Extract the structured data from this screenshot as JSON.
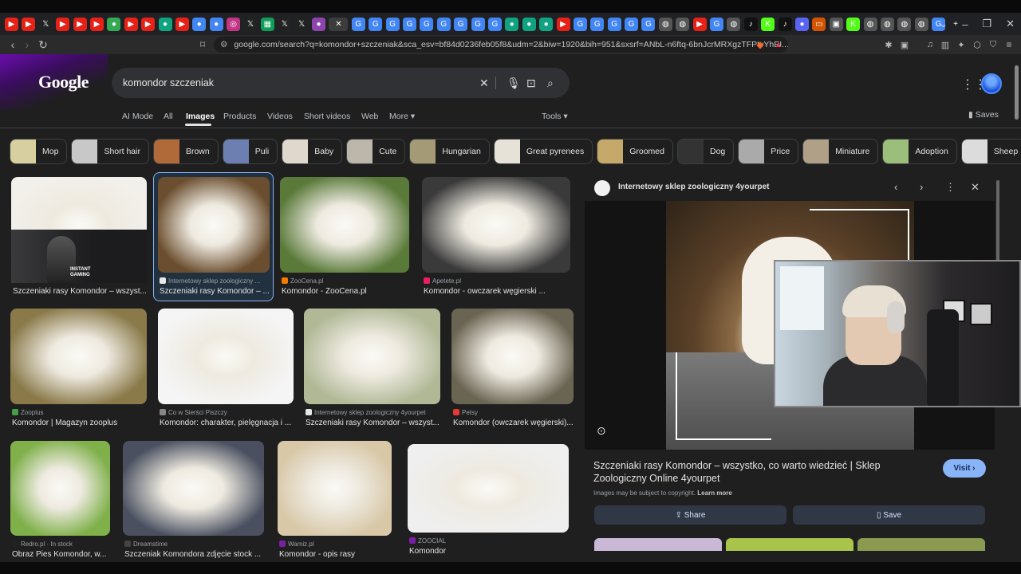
{
  "browser": {
    "url": "google.com/search?q=komondor+szczeniak&sca_esv=bf84d0236feb05f8&udm=2&biw=1920&bih=951&sxsrf=ANbL-n6ftq-6bnJcrMRXgzTFPtvYhEI...",
    "tabs": [
      {
        "icon": "youtube-icon",
        "color": "#e62117",
        "glyph": "▶"
      },
      {
        "icon": "youtube-icon",
        "color": "#e62117",
        "glyph": "▶"
      },
      {
        "icon": "x-icon",
        "color": "#222",
        "glyph": "𝕏"
      },
      {
        "icon": "youtube-icon",
        "color": "#e62117",
        "glyph": "▶"
      },
      {
        "icon": "youtube-icon",
        "color": "#e62117",
        "glyph": "▶"
      },
      {
        "icon": "youtube-icon",
        "color": "#e62117",
        "glyph": "▶"
      },
      {
        "icon": "maps-icon",
        "color": "#34a853",
        "glyph": "●"
      },
      {
        "icon": "youtube-icon",
        "color": "#e62117",
        "glyph": "▶"
      },
      {
        "icon": "youtube-icon",
        "color": "#e62117",
        "glyph": "▶"
      },
      {
        "icon": "chat-icon",
        "color": "#10a37f",
        "glyph": "●"
      },
      {
        "icon": "youtube-icon",
        "color": "#e62117",
        "glyph": "▶"
      },
      {
        "icon": "chrome-icon",
        "color": "#4285f4",
        "glyph": "●"
      },
      {
        "icon": "chrome-icon",
        "color": "#4285f4",
        "glyph": "●"
      },
      {
        "icon": "instagram-icon",
        "color": "#c13584",
        "glyph": "◎"
      },
      {
        "icon": "x-icon",
        "color": "#222",
        "glyph": "𝕏"
      },
      {
        "icon": "sheets-icon",
        "color": "#0f9d58",
        "glyph": "▦"
      },
      {
        "icon": "x-icon",
        "color": "#222",
        "glyph": "𝕏"
      },
      {
        "icon": "x-icon",
        "color": "#222",
        "glyph": "𝕏"
      },
      {
        "icon": "app-icon",
        "color": "#8e44ad",
        "glyph": "●"
      },
      {
        "icon": "close-tab-icon",
        "color": "#3c3c3c",
        "glyph": "✕",
        "active": true
      },
      {
        "icon": "google-icon",
        "color": "#4285f4",
        "glyph": "G"
      },
      {
        "icon": "google-icon",
        "color": "#4285f4",
        "glyph": "G"
      },
      {
        "icon": "google-icon",
        "color": "#4285f4",
        "glyph": "G"
      },
      {
        "icon": "google-icon",
        "color": "#4285f4",
        "glyph": "G"
      },
      {
        "icon": "google-icon",
        "color": "#4285f4",
        "glyph": "G"
      },
      {
        "icon": "google-icon",
        "color": "#4285f4",
        "glyph": "G"
      },
      {
        "icon": "google-icon",
        "color": "#4285f4",
        "glyph": "G"
      },
      {
        "icon": "google-icon",
        "color": "#4285f4",
        "glyph": "G"
      },
      {
        "icon": "google-icon",
        "color": "#4285f4",
        "glyph": "G"
      },
      {
        "icon": "chat-icon",
        "color": "#10a37f",
        "glyph": "●"
      },
      {
        "icon": "chat-icon",
        "color": "#10a37f",
        "glyph": "●"
      },
      {
        "icon": "chat-icon",
        "color": "#10a37f",
        "glyph": "●"
      },
      {
        "icon": "youtube-icon",
        "color": "#e62117",
        "glyph": "▶"
      },
      {
        "icon": "google-icon",
        "color": "#4285f4",
        "glyph": "G"
      },
      {
        "icon": "google-icon",
        "color": "#4285f4",
        "glyph": "G"
      },
      {
        "icon": "google-icon",
        "color": "#4285f4",
        "glyph": "G"
      },
      {
        "icon": "google-icon",
        "color": "#4285f4",
        "glyph": "G"
      },
      {
        "icon": "google-icon",
        "color": "#4285f4",
        "glyph": "G"
      },
      {
        "icon": "globe-icon",
        "color": "#555",
        "glyph": "◍"
      },
      {
        "icon": "globe-icon",
        "color": "#555",
        "glyph": "◍"
      },
      {
        "icon": "youtube-icon",
        "color": "#e62117",
        "glyph": "▶"
      },
      {
        "icon": "google-icon",
        "color": "#4285f4",
        "glyph": "G"
      },
      {
        "icon": "globe-icon",
        "color": "#555",
        "glyph": "◍"
      },
      {
        "icon": "tiktok-icon",
        "color": "#111",
        "glyph": "♪"
      },
      {
        "icon": "kick-icon",
        "color": "#53fc18",
        "glyph": "K"
      },
      {
        "icon": "tiktok-icon",
        "color": "#111",
        "glyph": "♪"
      },
      {
        "icon": "discord-icon",
        "color": "#5865f2",
        "glyph": "●"
      },
      {
        "icon": "app-icon",
        "color": "#d35400",
        "glyph": "▭"
      },
      {
        "icon": "app-icon",
        "color": "#555",
        "glyph": "▣"
      },
      {
        "icon": "kick-icon",
        "color": "#53fc18",
        "glyph": "K"
      },
      {
        "icon": "globe-icon",
        "color": "#555",
        "glyph": "◍"
      },
      {
        "icon": "globe-icon",
        "color": "#555",
        "glyph": "◍"
      },
      {
        "icon": "globe-icon",
        "color": "#555",
        "glyph": "◍"
      },
      {
        "icon": "globe-icon",
        "color": "#555",
        "glyph": "◍"
      },
      {
        "icon": "google-icon",
        "color": "#4285f4",
        "glyph": "G"
      },
      {
        "icon": "new-tab-icon",
        "color": "#202124",
        "glyph": "+"
      }
    ]
  },
  "header": {
    "logo_text": "Google",
    "search_query": "komondor szczeniak",
    "nav_tabs": [
      "AI Mode",
      "All",
      "Images",
      "Products",
      "Videos",
      "Short videos",
      "Web",
      "More ▾"
    ],
    "active_tab": "Images",
    "tools_label": "Tools ▾",
    "saves_label": "Saves"
  },
  "chips": [
    {
      "label": "Mop",
      "color": "#d8cfa0"
    },
    {
      "label": "Short hair",
      "color": "#c8c8c8"
    },
    {
      "label": "Brown",
      "color": "#b06a3a"
    },
    {
      "label": "Puli",
      "color": "#6d7fb0"
    },
    {
      "label": "Baby",
      "color": "#e0d8cc"
    },
    {
      "label": "Cute",
      "color": "#bdb6aa"
    },
    {
      "label": "Hungarian",
      "color": "#a49a76"
    },
    {
      "label": "Great pyrenees",
      "color": "#e6e2d8"
    },
    {
      "label": "Groomed",
      "color": "#c4a96a"
    },
    {
      "label": "Dog",
      "color": "#333"
    },
    {
      "label": "Price",
      "color": "#aaa"
    },
    {
      "label": "Miniature",
      "color": "#b0a088"
    },
    {
      "label": "Adoption",
      "color": "#9bbf7a"
    },
    {
      "label": "Sheep",
      "color": "#dcdcdc"
    }
  ],
  "results": [
    {
      "source": "",
      "title": "Szczeniaki rasy Komondor – wszyst...",
      "ico": "#e8e8e8",
      "img": "#f2f0ea"
    },
    {
      "source": "Internetowy sklep zoologiczny ...",
      "title": "Szczeniaki rasy Komondor – ...",
      "ico": "#e8e8e8",
      "img": "#6b4e2f"
    },
    {
      "source": "ZooCena.pl",
      "title": "Komondor - ZooCena.pl",
      "ico": "#f57c00",
      "img": "#5a7a3a"
    },
    {
      "source": "Apetete.pl",
      "title": "Komondor - owczarek węgierski ...",
      "ico": "#e91e63",
      "img": "#3a3a3a"
    },
    {
      "source": "Zooplus",
      "title": "Komondor | Magazyn zooplus",
      "ico": "#43a047",
      "img": "#8a7a4a"
    },
    {
      "source": "Co w Sierści Piszczy",
      "title": "Komondor: charakter, pielęgnacja i ...",
      "ico": "#888",
      "img": "#f5f5f5"
    },
    {
      "source": "Internetowy sklep zoologiczny 4yourpet",
      "title": "Szczeniaki rasy Komondor – wszyst...",
      "ico": "#e8e8e8",
      "img": "#b0b896"
    },
    {
      "source": "Petsy",
      "title": "Komondor (owczarek węgierski)...",
      "ico": "#e53935",
      "img": "#6a6452"
    },
    {
      "source": "Redro.pl · In stock",
      "title": "Obraz Pies Komondor, w...",
      "ico": "#222",
      "img": "#7fb04a"
    },
    {
      "source": "Dreamstime",
      "title": "Szczeniak Komondora zdjęcie stock ...",
      "ico": "#444",
      "img": "#4a5060"
    },
    {
      "source": "Wamiz.pl",
      "title": "Komondor - opis rasy",
      "ico": "#7b1fa2",
      "img": "#d8c8a8"
    },
    {
      "source": "ZOOCIAL",
      "title": "Komondor",
      "ico": "#7b1fa2",
      "img": "#efefef"
    }
  ],
  "overlay": {
    "instant_gaming": "INSTANT\nGAMING"
  },
  "panel": {
    "site_name": "Internetowy sklep zoologiczny 4yourpet",
    "title": "Szczeniaki rasy Komondor – wszystko, co warto wiedzieć | Sklep Zoologiczny Online 4yourpet",
    "visit_label": "Visit ›",
    "copyright_note": "Images may be subject to copyright.",
    "learn_more": "Learn more",
    "share_label": "Share",
    "save_label": "Save"
  }
}
